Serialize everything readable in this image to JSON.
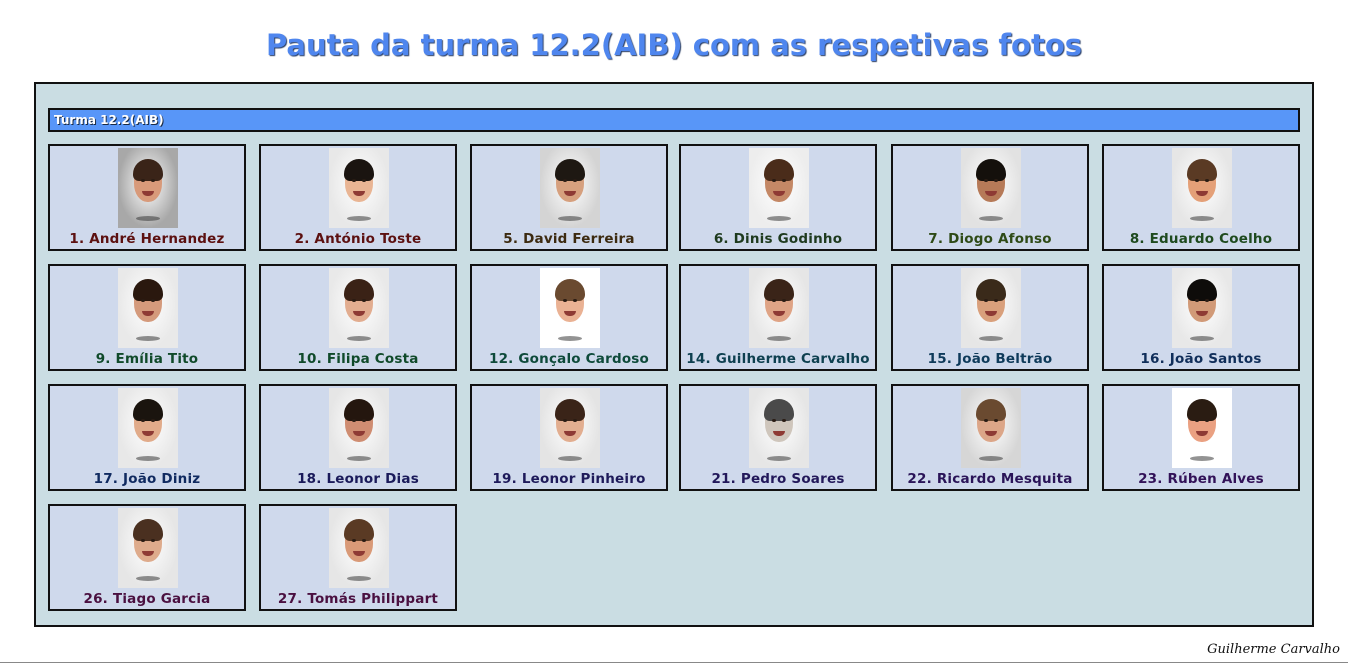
{
  "page": {
    "title": "Pauta da turma 12.2(AIB) com as respetivas fotos",
    "signature": "Guilherme Carvalho"
  },
  "group": {
    "label": "Turma 12.2(AIB)"
  },
  "colors": {
    "title": "#4f86ee",
    "group_bar": "#5896f8",
    "panel_bg": "#cadde3",
    "card_bg": "#cfd9ec"
  },
  "students": [
    {
      "label": "1. André Hernandez",
      "name_color": "#5c1010",
      "photo_bg": "#a8a8a8",
      "hair_color": "#3a2418",
      "skin_color": "#d89a7a"
    },
    {
      "label": "2. António Toste",
      "name_color": "#5c1010",
      "photo_bg": "#e8e8e8",
      "hair_color": "#1a1410",
      "skin_color": "#e9b594"
    },
    {
      "label": "5. David Ferreira",
      "name_color": "#3c2a10",
      "photo_bg": "#d4d4d4",
      "hair_color": "#1e1812",
      "skin_color": "#d6a07e"
    },
    {
      "label": "6. Dinis Godinho",
      "name_color": "#1e3a1e",
      "photo_bg": "#ededed",
      "hair_color": "#4a2c1a",
      "skin_color": "#c48866"
    },
    {
      "label": "7. Diogo Afonso",
      "name_color": "#2e4a16",
      "photo_bg": "#e2e2e2",
      "hair_color": "#14100c",
      "skin_color": "#b67a58"
    },
    {
      "label": "8. Eduardo Coelho",
      "name_color": "#1e4a1e",
      "photo_bg": "#e6e6e6",
      "hair_color": "#5a3a24",
      "skin_color": "#e4a078"
    },
    {
      "label": "9. Emília Tito",
      "name_color": "#104a2a",
      "photo_bg": "#e9e9e9",
      "hair_color": "#2a180e",
      "skin_color": "#d49a7c"
    },
    {
      "label": "10. Filipa Costa",
      "name_color": "#104a2a",
      "photo_bg": "#e9e9e9",
      "hair_color": "#3a2216",
      "skin_color": "#e2ad90"
    },
    {
      "label": "12. Gonçalo Cardoso",
      "name_color": "#0e4a3a",
      "photo_bg": "#ffffff",
      "hair_color": "#6a4a30",
      "skin_color": "#eab294"
    },
    {
      "label": "14. Guilherme Carvalho",
      "name_color": "#0e4050",
      "photo_bg": "#e6e6e6",
      "hair_color": "#3a2418",
      "skin_color": "#dfa486"
    },
    {
      "label": "15. João Beltrão",
      "name_color": "#0e3a5a",
      "photo_bg": "#e6e6e6",
      "hair_color": "#3a2a1a",
      "skin_color": "#d9a07c"
    },
    {
      "label": "16. João Santos",
      "name_color": "#102e5a",
      "photo_bg": "#e8e8e8",
      "hair_color": "#0e0c0a",
      "skin_color": "#d19a78"
    },
    {
      "label": "17. João Diniz",
      "name_color": "#102a60",
      "photo_bg": "#e8e8e8",
      "hair_color": "#1a140e",
      "skin_color": "#e1ab8a"
    },
    {
      "label": "18. Leonor Dias",
      "name_color": "#1a1a5a",
      "photo_bg": "#e6e6e6",
      "hair_color": "#24160e",
      "skin_color": "#cf8d72"
    },
    {
      "label": "19. Leonor Pinheiro",
      "name_color": "#1e1a5a",
      "photo_bg": "#e4e4e4",
      "hair_color": "#3a2418",
      "skin_color": "#e2ae90"
    },
    {
      "label": "21. Pedro Soares",
      "name_color": "#22185a",
      "photo_bg": "#e6e6e6",
      "hair_color": "#4a4a4a",
      "skin_color": "#cfc6bc"
    },
    {
      "label": "22. Ricardo Mesquita",
      "name_color": "#2a1458",
      "photo_bg": "#d6d6d6",
      "hair_color": "#6a4a30",
      "skin_color": "#dca688"
    },
    {
      "label": "23. Rúben Alves",
      "name_color": "#321258",
      "photo_bg": "#ffffff",
      "hair_color": "#2a1c12",
      "skin_color": "#eaa182"
    },
    {
      "label": "26. Tiago Garcia",
      "name_color": "#4a1040",
      "photo_bg": "#e6e6e6",
      "hair_color": "#4a3020",
      "skin_color": "#deab8c"
    },
    {
      "label": "27. Tomás Philippart",
      "name_color": "#4a1040",
      "photo_bg": "#e6e6e6",
      "hair_color": "#5a3a24",
      "skin_color": "#d99a78"
    }
  ]
}
